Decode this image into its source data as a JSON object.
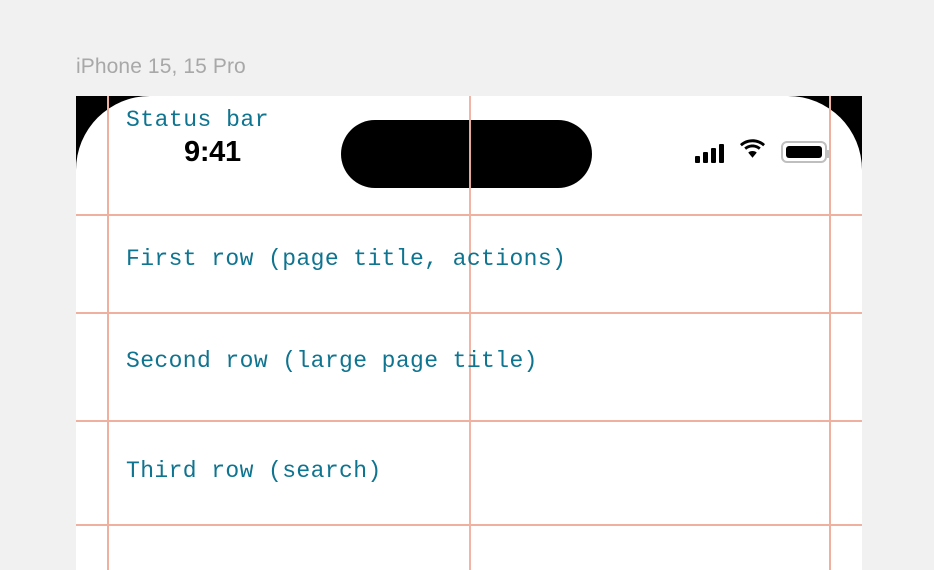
{
  "caption": "iPhone 15, 15 Pro",
  "device": {
    "status_bar": {
      "label": "Status bar",
      "time": "9:41",
      "icons": {
        "cellular": "cellular-signal-icon",
        "wifi": "wifi-icon",
        "battery": "battery-icon"
      }
    },
    "rows": [
      {
        "label": "First row (page title, actions)"
      },
      {
        "label": "Second row (large page title)"
      },
      {
        "label": "Third row (search)"
      }
    ]
  },
  "colors": {
    "background": "#f1f1f1",
    "guide": "#f0b0a0",
    "label_text": "#0e7490",
    "caption_text": "#a8a8a8",
    "bezel": "#000000",
    "screen": "#ffffff"
  }
}
